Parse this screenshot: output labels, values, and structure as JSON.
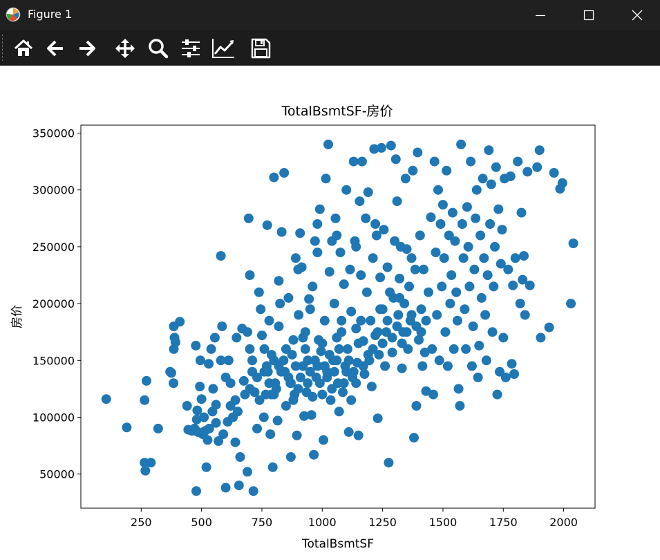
{
  "window": {
    "title": "Figure 1",
    "controls": [
      "minimize",
      "maximize",
      "close"
    ]
  },
  "toolbar": {
    "tools": [
      {
        "name": "home-icon"
      },
      {
        "name": "back-arrow-icon"
      },
      {
        "name": "forward-arrow-icon"
      },
      {
        "name": "pan-move-icon"
      },
      {
        "name": "zoom-magnifier-icon"
      },
      {
        "name": "configure-subplots-icon"
      },
      {
        "name": "edit-axis-line-icon"
      },
      {
        "name": "save-floppy-icon"
      }
    ]
  },
  "colors": {
    "marker": "#1f77b4",
    "titlebar": "#202020",
    "toolbar": "#1c1c1c"
  },
  "chart_data": {
    "type": "scatter",
    "title": "TotalBsmtSF-房价",
    "xlabel": "TotalBsmtSF",
    "ylabel": "房价",
    "xlim": [
      0,
      2130
    ],
    "ylim": [
      20000,
      357000
    ],
    "xticks": [
      250,
      500,
      750,
      1000,
      1250,
      1500,
      1750,
      2000
    ],
    "yticks": [
      50000,
      100000,
      150000,
      200000,
      250000,
      300000,
      350000
    ],
    "grid": false,
    "legend": "none",
    "points": [
      [
        105,
        116000
      ],
      [
        190,
        91000
      ],
      [
        264,
        60000
      ],
      [
        264,
        115000
      ],
      [
        267,
        53000
      ],
      [
        272,
        132000
      ],
      [
        290,
        60000
      ],
      [
        320,
        90000
      ],
      [
        370,
        140000
      ],
      [
        375,
        139000
      ],
      [
        384,
        130000
      ],
      [
        385,
        180000
      ],
      [
        385,
        160000
      ],
      [
        388,
        170000
      ],
      [
        392,
        166000
      ],
      [
        410,
        184000
      ],
      [
        440,
        110000
      ],
      [
        445,
        89000
      ],
      [
        460,
        88000
      ],
      [
        471,
        90000
      ],
      [
        476,
        163000
      ],
      [
        478,
        35000
      ],
      [
        480,
        98000
      ],
      [
        482,
        106000
      ],
      [
        485,
        87000
      ],
      [
        493,
        127000
      ],
      [
        495,
        150000
      ],
      [
        500,
        116000
      ],
      [
        505,
        85000
      ],
      [
        510,
        100000
      ],
      [
        515,
        88000
      ],
      [
        520,
        56000
      ],
      [
        525,
        80000
      ],
      [
        530,
        147000
      ],
      [
        532,
        90000
      ],
      [
        540,
        160000
      ],
      [
        545,
        105000
      ],
      [
        548,
        125000
      ],
      [
        555,
        170000
      ],
      [
        560,
        111000
      ],
      [
        570,
        79000
      ],
      [
        580,
        242000
      ],
      [
        585,
        180000
      ],
      [
        590,
        85000
      ],
      [
        600,
        38000
      ],
      [
        608,
        96000
      ],
      [
        612,
        150000
      ],
      [
        620,
        130000
      ],
      [
        630,
        100000
      ],
      [
        640,
        78000
      ],
      [
        645,
        170000
      ],
      [
        650,
        105000
      ],
      [
        655,
        40000
      ],
      [
        660,
        65000
      ],
      [
        668,
        178000
      ],
      [
        675,
        132000
      ],
      [
        690,
        52000
      ],
      [
        695,
        275000
      ],
      [
        700,
        160000
      ],
      [
        700,
        225000
      ],
      [
        710,
        140000
      ],
      [
        715,
        35000
      ],
      [
        720,
        122000
      ],
      [
        730,
        90000
      ],
      [
        738,
        210000
      ],
      [
        745,
        195000
      ],
      [
        750,
        172000
      ],
      [
        758,
        100000
      ],
      [
        766,
        120000
      ],
      [
        772,
        269000
      ],
      [
        775,
        140000
      ],
      [
        780,
        185000
      ],
      [
        785,
        85000
      ],
      [
        790,
        120000
      ],
      [
        795,
        56000
      ],
      [
        800,
        311000
      ],
      [
        800,
        150000
      ],
      [
        805,
        130000
      ],
      [
        815,
        97000
      ],
      [
        820,
        180000
      ],
      [
        825,
        200000
      ],
      [
        832,
        263000
      ],
      [
        842,
        315000
      ],
      [
        845,
        140000
      ],
      [
        850,
        110000
      ],
      [
        860,
        205000
      ],
      [
        868,
        130000
      ],
      [
        870,
        65000
      ],
      [
        875,
        155000
      ],
      [
        880,
        168000
      ],
      [
        885,
        120000
      ],
      [
        890,
        240000
      ],
      [
        895,
        84000
      ],
      [
        902,
        190000
      ],
      [
        908,
        262000
      ],
      [
        915,
        232000
      ],
      [
        920,
        145000
      ],
      [
        925,
        101000
      ],
      [
        930,
        175000
      ],
      [
        935,
        122000
      ],
      [
        940,
        150000
      ],
      [
        945,
        204000
      ],
      [
        950,
        195000
      ],
      [
        955,
        102000
      ],
      [
        960,
        215000
      ],
      [
        965,
        67000
      ],
      [
        970,
        255000
      ],
      [
        975,
        135000
      ],
      [
        980,
        270000
      ],
      [
        985,
        168000
      ],
      [
        990,
        283000
      ],
      [
        995,
        158000
      ],
      [
        1000,
        120000
      ],
      [
        1005,
        80000
      ],
      [
        1010,
        185000
      ],
      [
        1015,
        310000
      ],
      [
        1020,
        140000
      ],
      [
        1025,
        340000
      ],
      [
        1030,
        228000
      ],
      [
        1035,
        115000
      ],
      [
        1040,
        255000
      ],
      [
        1045,
        150000
      ],
      [
        1050,
        200000
      ],
      [
        1055,
        275000
      ],
      [
        1060,
        170000
      ],
      [
        1065,
        130000
      ],
      [
        1070,
        105000
      ],
      [
        1075,
        245000
      ],
      [
        1080,
        185000
      ],
      [
        1085,
        122000
      ],
      [
        1090,
        217000
      ],
      [
        1095,
        145000
      ],
      [
        1100,
        300000
      ],
      [
        1105,
        160000
      ],
      [
        1110,
        87000
      ],
      [
        1115,
        230000
      ],
      [
        1120,
        193000
      ],
      [
        1125,
        135000
      ],
      [
        1130,
        325000
      ],
      [
        1135,
        255000
      ],
      [
        1140,
        178000
      ],
      [
        1145,
        148000
      ],
      [
        1150,
        84000
      ],
      [
        1155,
        290000
      ],
      [
        1160,
        225000
      ],
      [
        1165,
        325000
      ],
      [
        1170,
        167000
      ],
      [
        1175,
        138000
      ],
      [
        1180,
        275000
      ],
      [
        1185,
        210000
      ],
      [
        1190,
        298000
      ],
      [
        1195,
        150000
      ],
      [
        1200,
        185000
      ],
      [
        1205,
        127000
      ],
      [
        1210,
        240000
      ],
      [
        1215,
        336000
      ],
      [
        1220,
        172000
      ],
      [
        1225,
        260000
      ],
      [
        1230,
        99000
      ],
      [
        1235,
        155000
      ],
      [
        1240,
        223000
      ],
      [
        1245,
        337000
      ],
      [
        1250,
        195000
      ],
      [
        1255,
        265000
      ],
      [
        1260,
        145000
      ],
      [
        1265,
        175000
      ],
      [
        1270,
        232000
      ],
      [
        1275,
        60000
      ],
      [
        1280,
        210000
      ],
      [
        1285,
        339000
      ],
      [
        1290,
        157000
      ],
      [
        1295,
        205000
      ],
      [
        1300,
        255000
      ],
      [
        1305,
        327000
      ],
      [
        1310,
        290000
      ],
      [
        1315,
        190000
      ],
      [
        1320,
        222000
      ],
      [
        1325,
        250000
      ],
      [
        1330,
        143000
      ],
      [
        1335,
        175000
      ],
      [
        1340,
        200000
      ],
      [
        1345,
        310000
      ],
      [
        1350,
        248000
      ],
      [
        1355,
        160000
      ],
      [
        1360,
        215000
      ],
      [
        1365,
        185000
      ],
      [
        1370,
        240000
      ],
      [
        1375,
        317000
      ],
      [
        1380,
        82000
      ],
      [
        1385,
        230000
      ],
      [
        1390,
        110000
      ],
      [
        1395,
        333000
      ],
      [
        1400,
        168000
      ],
      [
        1405,
        260000
      ],
      [
        1410,
        195000
      ],
      [
        1415,
        145000
      ],
      [
        1420,
        230000
      ],
      [
        1425,
        157000
      ],
      [
        1430,
        123000
      ],
      [
        1440,
        210000
      ],
      [
        1450,
        276000
      ],
      [
        1455,
        160000
      ],
      [
        1460,
        120000
      ],
      [
        1465,
        325000
      ],
      [
        1470,
        245000
      ],
      [
        1475,
        190000
      ],
      [
        1480,
        300000
      ],
      [
        1485,
        150000
      ],
      [
        1490,
        270000
      ],
      [
        1495,
        215000
      ],
      [
        1500,
        287000
      ],
      [
        1505,
        240000
      ],
      [
        1510,
        175000
      ],
      [
        1515,
        317000
      ],
      [
        1520,
        145000
      ],
      [
        1525,
        260000
      ],
      [
        1530,
        200000
      ],
      [
        1535,
        225000
      ],
      [
        1540,
        280000
      ],
      [
        1545,
        160000
      ],
      [
        1550,
        255000
      ],
      [
        1555,
        210000
      ],
      [
        1560,
        185000
      ],
      [
        1565,
        125000
      ],
      [
        1570,
        110000
      ],
      [
        1575,
        340000
      ],
      [
        1580,
        270000
      ],
      [
        1585,
        240000
      ],
      [
        1590,
        195000
      ],
      [
        1595,
        160000
      ],
      [
        1600,
        285000
      ],
      [
        1605,
        250000
      ],
      [
        1610,
        215000
      ],
      [
        1615,
        325000
      ],
      [
        1620,
        145000
      ],
      [
        1625,
        180000
      ],
      [
        1630,
        230000
      ],
      [
        1635,
        275000
      ],
      [
        1640,
        300000
      ],
      [
        1645,
        135000
      ],
      [
        1650,
        163000
      ],
      [
        1655,
        260000
      ],
      [
        1660,
        205000
      ],
      [
        1665,
        310000
      ],
      [
        1670,
        240000
      ],
      [
        1675,
        190000
      ],
      [
        1680,
        150000
      ],
      [
        1685,
        225000
      ],
      [
        1690,
        335000
      ],
      [
        1695,
        270000
      ],
      [
        1700,
        305000
      ],
      [
        1705,
        175000
      ],
      [
        1710,
        215000
      ],
      [
        1715,
        250000
      ],
      [
        1720,
        320000
      ],
      [
        1725,
        120000
      ],
      [
        1730,
        283000
      ],
      [
        1735,
        140000
      ],
      [
        1740,
        235000
      ],
      [
        1745,
        265000
      ],
      [
        1750,
        170000
      ],
      [
        1755,
        310000
      ],
      [
        1760,
        135000
      ],
      [
        1770,
        230000
      ],
      [
        1780,
        312000
      ],
      [
        1785,
        147000
      ],
      [
        1790,
        216000
      ],
      [
        1795,
        138000
      ],
      [
        1800,
        240000
      ],
      [
        1810,
        325000
      ],
      [
        1820,
        200000
      ],
      [
        1825,
        280000
      ],
      [
        1830,
        221000
      ],
      [
        1835,
        242000
      ],
      [
        1840,
        190000
      ],
      [
        1850,
        316000
      ],
      [
        1860,
        216000
      ],
      [
        1890,
        320000
      ],
      [
        1900,
        335000
      ],
      [
        1905,
        170000
      ],
      [
        1940,
        179000
      ],
      [
        1960,
        315000
      ],
      [
        1985,
        301000
      ],
      [
        1995,
        306000
      ],
      [
        2030,
        200000
      ],
      [
        2040,
        253000
      ],
      [
        690,
        175000
      ],
      [
        710,
        150000
      ],
      [
        730,
        135000
      ],
      [
        760,
        160000
      ],
      [
        770,
        145000
      ],
      [
        790,
        155000
      ],
      [
        810,
        125000
      ],
      [
        830,
        140000
      ],
      [
        850,
        160000
      ],
      [
        870,
        130000
      ],
      [
        890,
        145000
      ],
      [
        910,
        135000
      ],
      [
        930,
        160000
      ],
      [
        950,
        140000
      ],
      [
        970,
        150000
      ],
      [
        990,
        130000
      ],
      [
        1010,
        145000
      ],
      [
        1030,
        155000
      ],
      [
        1050,
        140000
      ],
      [
        1070,
        160000
      ],
      [
        1090,
        130000
      ],
      [
        1110,
        150000
      ],
      [
        1130,
        140000
      ],
      [
        1150,
        165000
      ],
      [
        1170,
        145000
      ],
      [
        1190,
        155000
      ],
      [
        1210,
        160000
      ],
      [
        1230,
        175000
      ],
      [
        1250,
        165000
      ],
      [
        1270,
        185000
      ],
      [
        1290,
        170000
      ],
      [
        1310,
        180000
      ],
      [
        1330,
        165000
      ],
      [
        1350,
        175000
      ],
      [
        1370,
        190000
      ],
      [
        1390,
        180000
      ],
      [
        1410,
        175000
      ],
      [
        1430,
        185000
      ],
      [
        780,
        130000
      ],
      [
        820,
        145000
      ],
      [
        860,
        135000
      ],
      [
        900,
        125000
      ],
      [
        940,
        130000
      ],
      [
        980,
        145000
      ],
      [
        1020,
        135000
      ],
      [
        1060,
        150000
      ],
      [
        1100,
        140000
      ],
      [
        1140,
        130000
      ],
      [
        740,
        115000
      ],
      [
        800,
        120000
      ],
      [
        880,
        115000
      ],
      [
        960,
        118000
      ],
      [
        1040,
        125000
      ],
      [
        1120,
        115000
      ],
      [
        700,
        125000
      ],
      [
        760,
        140000
      ],
      [
        840,
        150000
      ],
      [
        920,
        170000
      ],
      [
        1000,
        165000
      ],
      [
        1080,
        175000
      ],
      [
        1160,
        185000
      ],
      [
        1240,
        195000
      ],
      [
        1320,
        205000
      ],
      [
        820,
        220000
      ],
      [
        900,
        230000
      ],
      [
        980,
        245000
      ],
      [
        1060,
        260000
      ],
      [
        1140,
        250000
      ],
      [
        1220,
        270000
      ],
      [
        640,
        115000
      ],
      [
        600,
        135000
      ],
      [
        580,
        150000
      ],
      [
        560,
        95000
      ],
      [
        620,
        110000
      ],
      [
        680,
        120000
      ]
    ]
  }
}
